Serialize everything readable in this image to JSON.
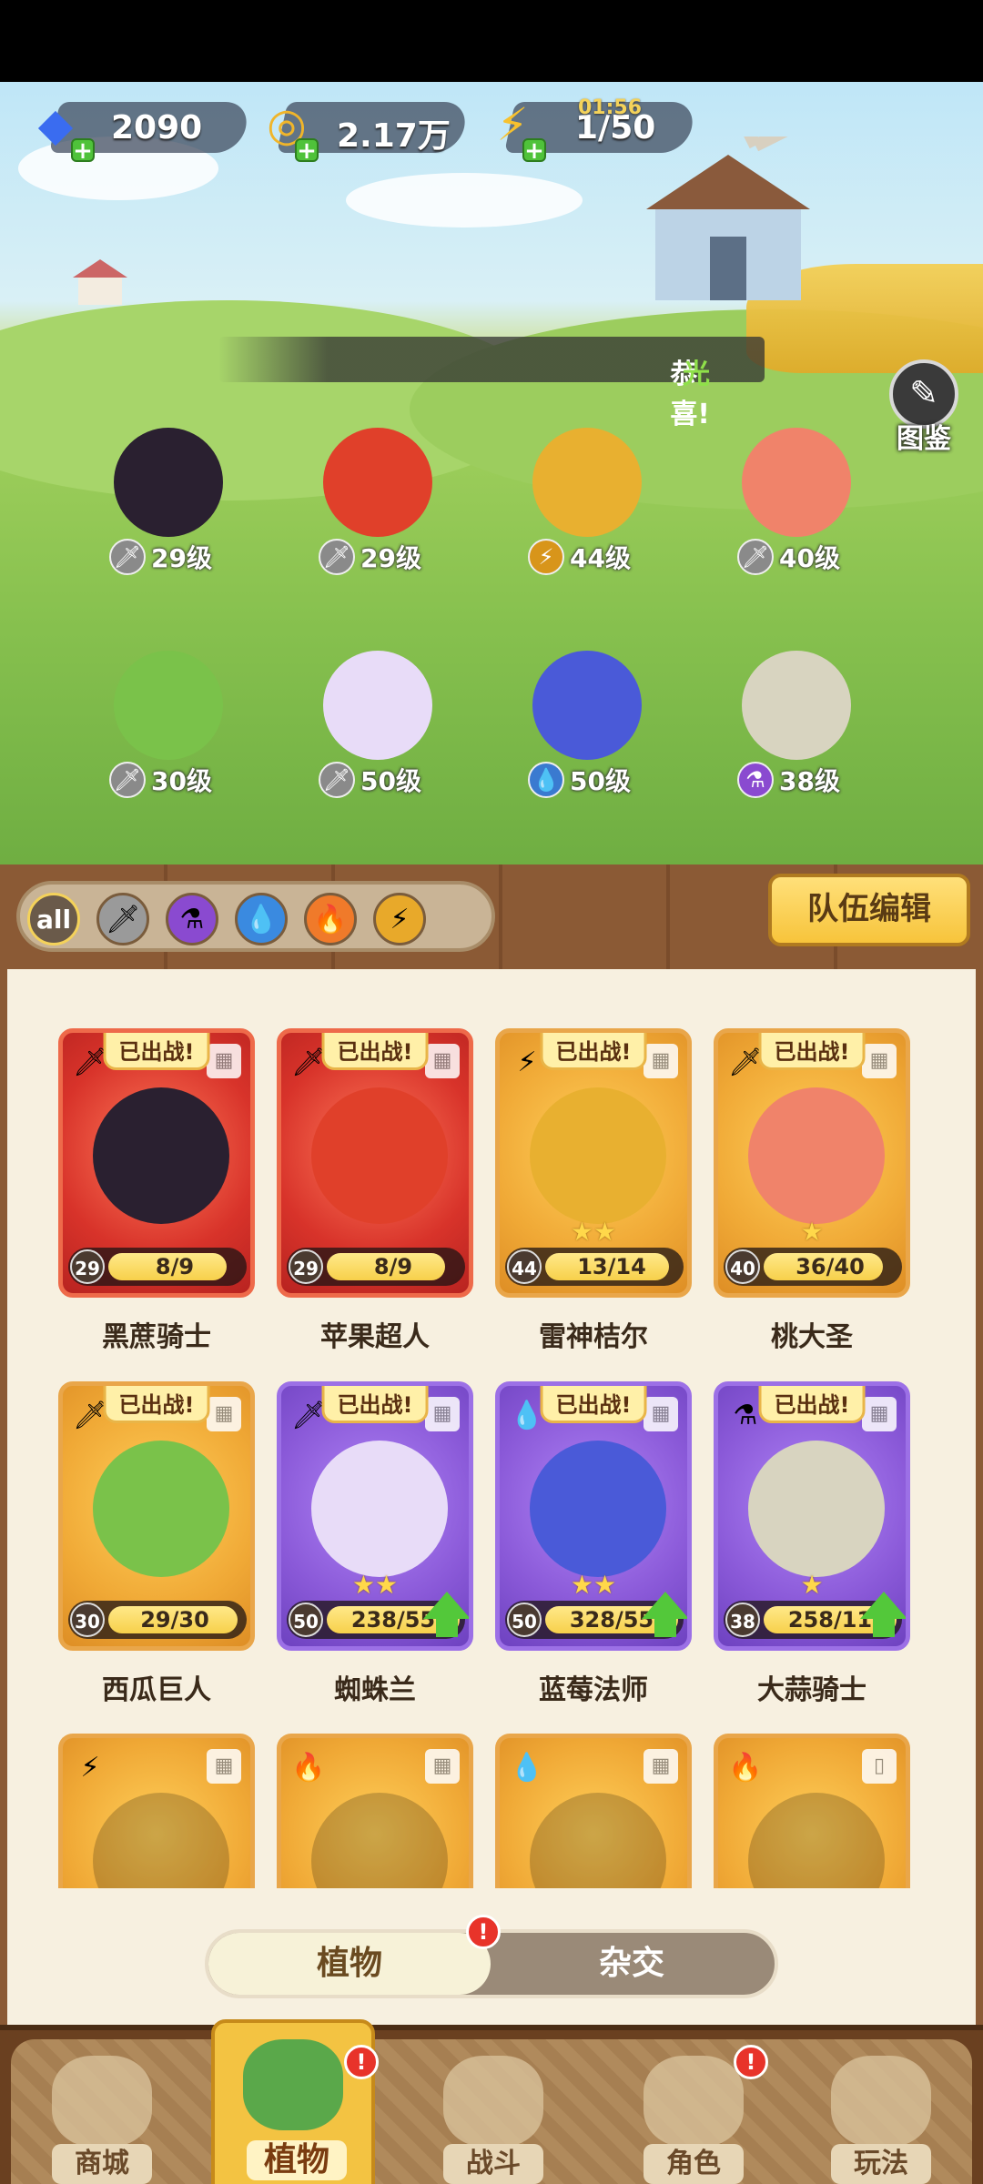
{
  "resources": {
    "gems": "2090",
    "coins": "2.17万",
    "energy": "1/50",
    "energy_timer": "01:56"
  },
  "scene": {
    "congrats_prefix": "恭喜!",
    "congrats_highlight": "光",
    "tujian_label": "图鉴"
  },
  "lineup": [
    {
      "level": "29级",
      "element": "sword"
    },
    {
      "level": "29级",
      "element": "sword"
    },
    {
      "level": "44级",
      "element": "lightning"
    },
    {
      "level": "40级",
      "element": "sword"
    },
    {
      "level": "30级",
      "element": "sword"
    },
    {
      "level": "50级",
      "element": "sword"
    },
    {
      "level": "50级",
      "element": "water"
    },
    {
      "level": "38级",
      "element": "poison"
    }
  ],
  "filters": {
    "all_label": "all",
    "team_edit_label": "队伍编辑"
  },
  "cards": [
    {
      "name": "黑蔗骑士",
      "badge": "已出战!",
      "level": "29",
      "progress": "8/9",
      "fill": 0.89,
      "stars": "",
      "color": "red",
      "element": "sword"
    },
    {
      "name": "苹果超人",
      "badge": "已出战!",
      "level": "29",
      "progress": "8/9",
      "fill": 0.89,
      "stars": "",
      "color": "red",
      "element": "sword"
    },
    {
      "name": "雷神桔尔",
      "badge": "已出战!",
      "level": "44",
      "progress": "13/14",
      "fill": 0.93,
      "stars": "★★",
      "color": "gold",
      "element": "lightning"
    },
    {
      "name": "桃大圣",
      "badge": "已出战!",
      "level": "40",
      "progress": "36/40",
      "fill": 0.9,
      "stars": "★",
      "color": "gold",
      "element": "sword"
    },
    {
      "name": "西瓜巨人",
      "badge": "已出战!",
      "level": "30",
      "progress": "29/30",
      "fill": 0.97,
      "stars": "",
      "color": "gold",
      "element": "sword"
    },
    {
      "name": "蜘蛛兰",
      "badge": "已出战!",
      "level": "50",
      "progress": "238/55",
      "fill": 1,
      "stars": "★★",
      "color": "purple",
      "element": "sword"
    },
    {
      "name": "蓝莓法师",
      "badge": "已出战!",
      "level": "50",
      "progress": "328/55",
      "fill": 1,
      "stars": "★★",
      "color": "purple",
      "element": "water"
    },
    {
      "name": "大蒜骑士",
      "badge": "已出战!",
      "level": "38",
      "progress": "258/11",
      "fill": 1,
      "stars": "★",
      "color": "purple",
      "element": "poison"
    }
  ],
  "segment": {
    "plants": "植物",
    "hybrid": "杂交",
    "alert": "!"
  },
  "nav": [
    {
      "label": "商城"
    },
    {
      "label": "植物"
    },
    {
      "label": "战斗"
    },
    {
      "label": "角色"
    },
    {
      "label": "玩法"
    }
  ],
  "colors": {
    "accent": "#f3c342",
    "panel": "#f7f0e0",
    "wood": "#8b5a35"
  }
}
